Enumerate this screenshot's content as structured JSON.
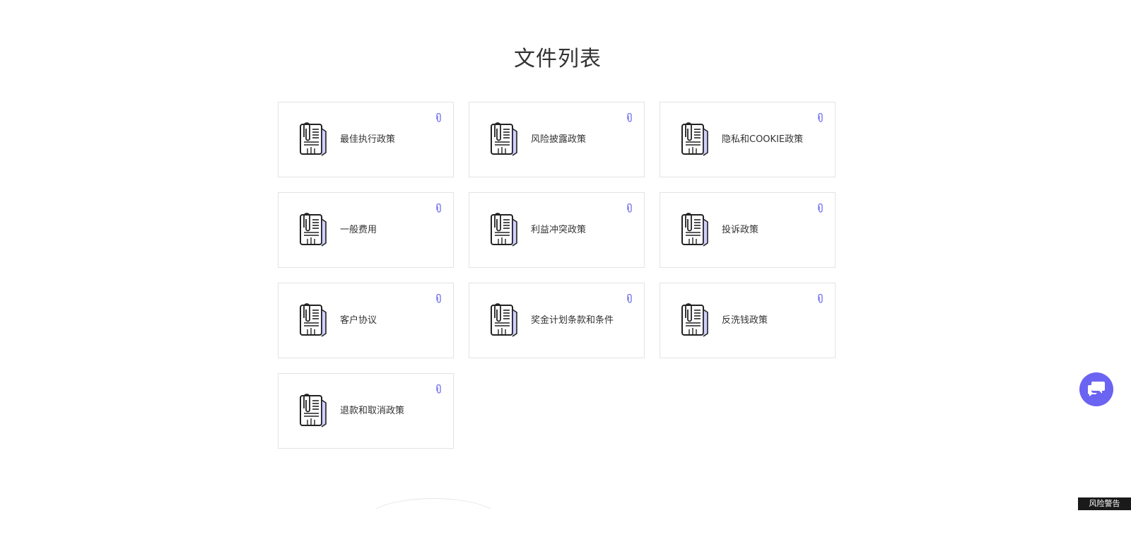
{
  "page": {
    "title": "文件列表"
  },
  "documents": [
    {
      "label": "最佳执行政策",
      "icon": "document-paperclip-icon",
      "badge_icon": "attachment-icon"
    },
    {
      "label": "风险披露政策",
      "icon": "document-paperclip-icon",
      "badge_icon": "attachment-icon"
    },
    {
      "label": "隐私和COOKIE政策",
      "icon": "document-paperclip-icon",
      "badge_icon": "attachment-icon"
    },
    {
      "label": "一般费用",
      "icon": "document-paperclip-icon",
      "badge_icon": "attachment-icon"
    },
    {
      "label": "利益冲突政策",
      "icon": "document-paperclip-icon",
      "badge_icon": "attachment-icon"
    },
    {
      "label": "投诉政策",
      "icon": "document-paperclip-icon",
      "badge_icon": "attachment-icon"
    },
    {
      "label": "客户协议",
      "icon": "document-paperclip-icon",
      "badge_icon": "attachment-icon"
    },
    {
      "label": "奖金计划条款和条件",
      "icon": "document-paperclip-icon",
      "badge_icon": "attachment-icon"
    },
    {
      "label": "反洗钱政策",
      "icon": "document-paperclip-icon",
      "badge_icon": "attachment-icon"
    },
    {
      "label": "退款和取消政策",
      "icon": "document-paperclip-icon",
      "badge_icon": "attachment-icon"
    }
  ],
  "chat_widget": {
    "icon": "chat-bubbles-icon",
    "color": "#6b63f2"
  },
  "risk_warning": {
    "label": "风险警告"
  },
  "colors": {
    "card_border": "#e3e3e3",
    "attachment_accent": "#7b79f0",
    "text": "#333333"
  }
}
